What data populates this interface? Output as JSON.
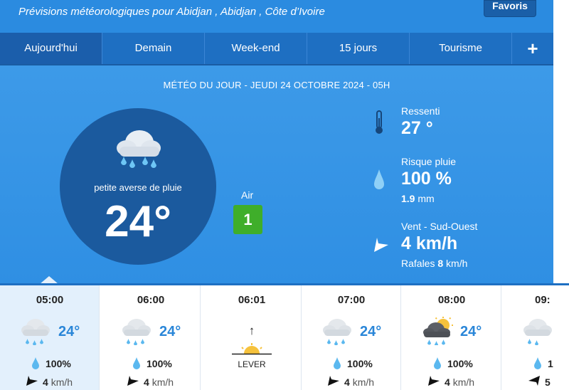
{
  "header": {
    "title": "Prévisions météorologiques pour Abidjan , Abidjan , Côte d’Ivoire",
    "favorites_label": "Favoris"
  },
  "tabs": [
    {
      "label": "Aujourd'hui",
      "active": true
    },
    {
      "label": "Demain"
    },
    {
      "label": "Week-end"
    },
    {
      "label": "15 jours"
    },
    {
      "label": "Tourisme"
    }
  ],
  "tabs_more_label": "+",
  "today": {
    "date_line": "MÉTÉO DU JOUR - JEUDI 24 OCTOBRE 2024 - 05H",
    "condition": "petite averse de pluie",
    "temperature": "24°",
    "icon": "cloud-rain-icon",
    "air_label": "Air",
    "air_value": "1",
    "air_color": "#3fae2a",
    "feels_label": "Ressenti",
    "feels_value": "27 °",
    "rain_label": "Risque pluie",
    "rain_value": "100 %",
    "rain_amount": "1.9",
    "rain_unit": "mm",
    "wind_label": "Vent - Sud-Ouest",
    "wind_value": "4 km/h",
    "gusts_label": "Rafales",
    "gusts_value": "8",
    "gusts_unit": "km/h"
  },
  "hourly": [
    {
      "time": "05:00",
      "temp": "24°",
      "rain": "100%",
      "wind": "4",
      "unit": "km/h",
      "icon": "cloud-rain-icon"
    },
    {
      "time": "06:00",
      "temp": "24°",
      "rain": "100%",
      "wind": "4",
      "unit": "km/h",
      "icon": "cloud-rain-icon"
    },
    {
      "time": "06:01",
      "label": "LEVER",
      "icon": "sunrise-icon"
    },
    {
      "time": "07:00",
      "temp": "24°",
      "rain": "100%",
      "wind": "4",
      "unit": "km/h",
      "icon": "cloud-rain-icon"
    },
    {
      "time": "08:00",
      "temp": "24°",
      "rain": "100%",
      "wind": "4",
      "unit": "km/h",
      "icon": "sun-cloud-rain-icon"
    },
    {
      "time": "09:",
      "temp": "",
      "rain": "1",
      "wind": "5",
      "unit": "",
      "icon": "cloud-rain-icon"
    }
  ],
  "colors": {
    "accent": "#2b8be0",
    "tab_bar": "#1e6fc2",
    "circle": "#1b5a9e",
    "temp_blue": "#2a86d8"
  }
}
